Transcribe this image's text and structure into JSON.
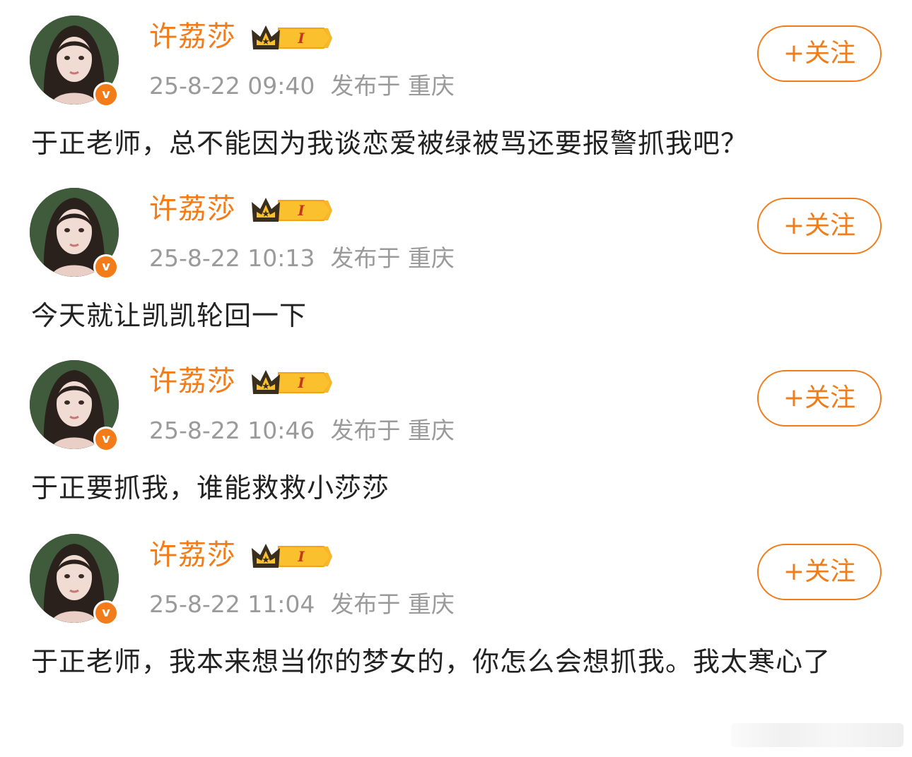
{
  "colors": {
    "accent": "#f27c1a",
    "meta_text": "#9a9a9a",
    "body_text": "#222222"
  },
  "posts": [
    {
      "username": "许荔莎",
      "level": "I",
      "timestamp": "25-8-22 09:40",
      "location": "发布于 重庆",
      "follow_label": "+关注",
      "verified_mark": "v",
      "text": "于正老师，总不能因为我谈恋爱被绿被骂还要报警抓我吧？"
    },
    {
      "username": "许荔莎",
      "level": "I",
      "timestamp": "25-8-22 10:13",
      "location": "发布于 重庆",
      "follow_label": "+关注",
      "verified_mark": "v",
      "text": "今天就让凯凯轮回一下"
    },
    {
      "username": "许荔莎",
      "level": "I",
      "timestamp": "25-8-22 10:46",
      "location": "发布于 重庆",
      "follow_label": "+关注",
      "verified_mark": "v",
      "text": "于正要抓我，谁能救救小莎莎"
    },
    {
      "username": "许荔莎",
      "level": "I",
      "timestamp": "25-8-22 11:04",
      "location": "发布于 重庆",
      "follow_label": "+关注",
      "verified_mark": "v",
      "text": "于正老师，我本来想当你的梦女的，你怎么会想抓我。我太寒心了"
    }
  ]
}
